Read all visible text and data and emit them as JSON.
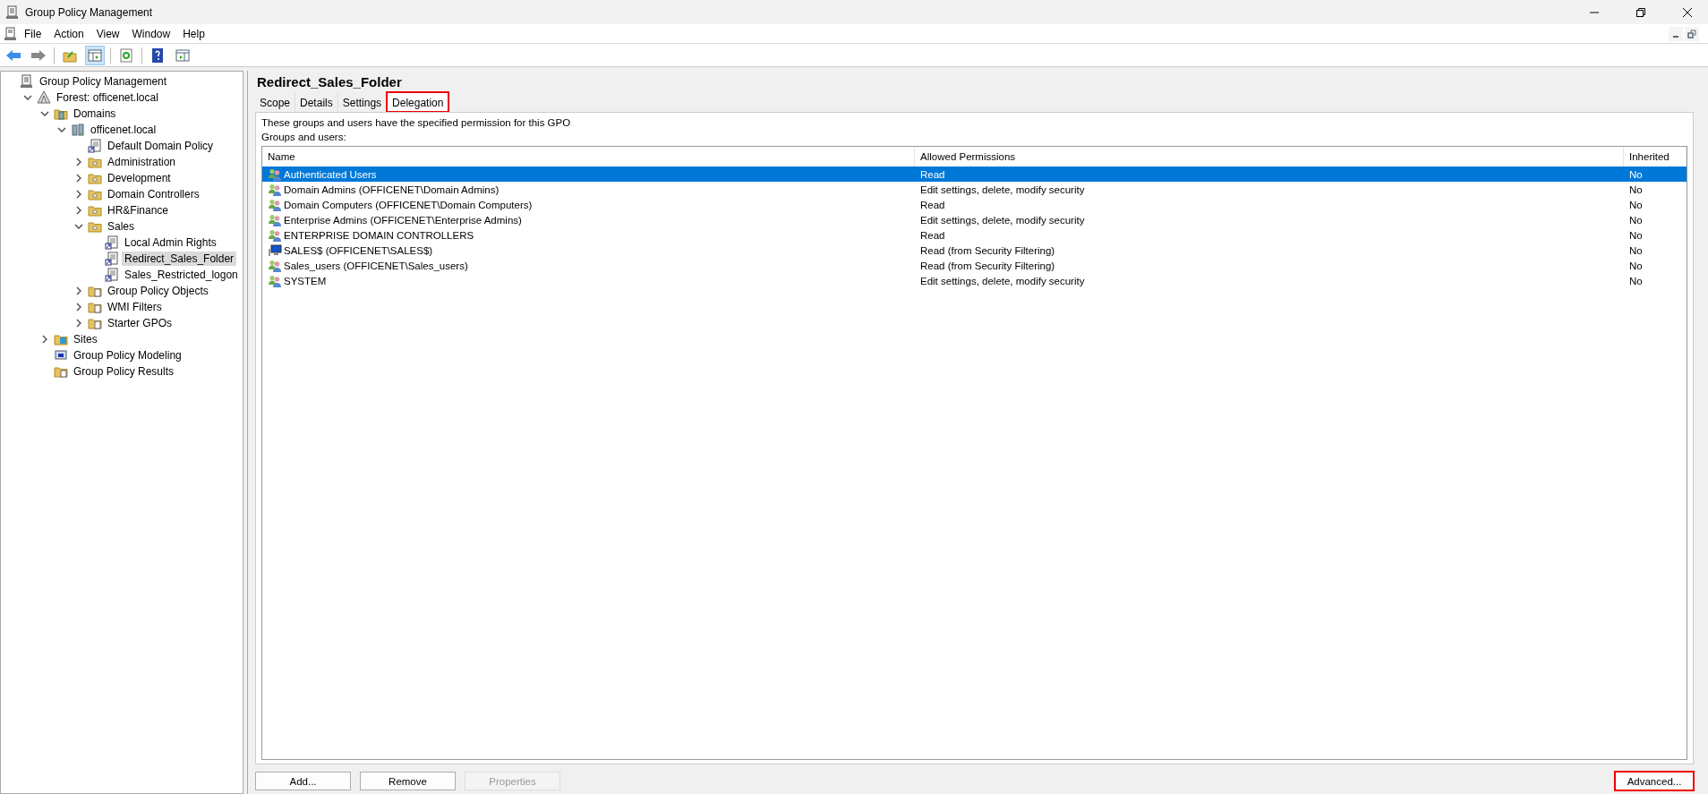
{
  "window": {
    "title": "Group Policy Management"
  },
  "menu": [
    "File",
    "Action",
    "View",
    "Window",
    "Help"
  ],
  "tree": [
    {
      "label": "Group Policy Management",
      "kind": "root",
      "selected": false,
      "children": [
        {
          "label": "Forest: officenet.local",
          "kind": "forest",
          "expanded": true,
          "selected": false,
          "children": [
            {
              "label": "Domains",
              "kind": "domains",
              "expanded": true,
              "selected": false,
              "children": [
                {
                  "label": "officenet.local",
                  "kind": "domain",
                  "expanded": true,
                  "selected": false,
                  "children": [
                    {
                      "label": "Default Domain Policy",
                      "kind": "gpo",
                      "selected": false
                    },
                    {
                      "label": "Administration",
                      "kind": "ou",
                      "expanded": false,
                      "selected": false
                    },
                    {
                      "label": "Development",
                      "kind": "ou",
                      "expanded": false,
                      "selected": false
                    },
                    {
                      "label": "Domain Controllers",
                      "kind": "ou",
                      "expanded": false,
                      "selected": false
                    },
                    {
                      "label": "HR&Finance",
                      "kind": "ou",
                      "expanded": false,
                      "selected": false
                    },
                    {
                      "label": "Sales",
                      "kind": "ou",
                      "expanded": true,
                      "selected": false,
                      "children": [
                        {
                          "label": "Local Admin Rights",
                          "kind": "gpo",
                          "selected": false
                        },
                        {
                          "label": "Redirect_Sales_Folder",
                          "kind": "gpo",
                          "selected": true
                        },
                        {
                          "label": "Sales_Restricted_logon",
                          "kind": "gpo",
                          "selected": false
                        }
                      ]
                    },
                    {
                      "label": "Group Policy Objects",
                      "kind": "container",
                      "expanded": false,
                      "selected": false
                    },
                    {
                      "label": "WMI Filters",
                      "kind": "container",
                      "expanded": false,
                      "selected": false
                    },
                    {
                      "label": "Starter GPOs",
                      "kind": "container",
                      "expanded": false,
                      "selected": false
                    }
                  ]
                }
              ]
            },
            {
              "label": "Sites",
              "kind": "sites",
              "expanded": false,
              "selected": false
            },
            {
              "label": "Group Policy Modeling",
              "kind": "modeling",
              "selected": false
            },
            {
              "label": "Group Policy Results",
              "kind": "results",
              "selected": false
            }
          ]
        }
      ]
    }
  ],
  "pane": {
    "title": "Redirect_Sales_Folder",
    "tabs": [
      {
        "label": "Scope",
        "selected": false,
        "highlighted": false
      },
      {
        "label": "Details",
        "selected": false,
        "highlighted": false
      },
      {
        "label": "Settings",
        "selected": false,
        "highlighted": false
      },
      {
        "label": "Delegation",
        "selected": true,
        "highlighted": true
      }
    ],
    "description": "These groups and users have the specified permission for this GPO",
    "list_label": "Groups and users:",
    "table": {
      "columns": [
        "Name",
        "Allowed Permissions",
        "Inherited"
      ],
      "rows": [
        {
          "kind": "group",
          "name": "Authenticated Users",
          "permissions": "Read",
          "inherited": "No",
          "selected": true
        },
        {
          "kind": "group",
          "name": "Domain Admins (OFFICENET\\Domain Admins)",
          "permissions": "Edit settings, delete, modify security",
          "inherited": "No",
          "selected": false
        },
        {
          "kind": "group",
          "name": "Domain Computers (OFFICENET\\Domain Computers)",
          "permissions": "Read",
          "inherited": "No",
          "selected": false
        },
        {
          "kind": "group",
          "name": "Enterprise Admins (OFFICENET\\Enterprise Admins)",
          "permissions": "Edit settings, delete, modify security",
          "inherited": "No",
          "selected": false
        },
        {
          "kind": "group",
          "name": "ENTERPRISE DOMAIN CONTROLLERS",
          "permissions": "Read",
          "inherited": "No",
          "selected": false
        },
        {
          "kind": "computer",
          "name": "SALES$ (OFFICENET\\SALES$)",
          "permissions": "Read (from Security Filtering)",
          "inherited": "No",
          "selected": false
        },
        {
          "kind": "group",
          "name": "Sales_users (OFFICENET\\Sales_users)",
          "permissions": "Read (from Security Filtering)",
          "inherited": "No",
          "selected": false
        },
        {
          "kind": "group",
          "name": "SYSTEM",
          "permissions": "Edit settings, delete, modify security",
          "inherited": "No",
          "selected": false
        }
      ]
    },
    "buttons": [
      {
        "label": "Add...",
        "disabled": false,
        "highlighted": false
      },
      {
        "label": "Remove",
        "disabled": false,
        "highlighted": false
      },
      {
        "label": "Properties",
        "disabled": true,
        "highlighted": false
      }
    ],
    "advanced_button": {
      "label": "Advanced...",
      "disabled": false,
      "highlighted": true
    }
  }
}
